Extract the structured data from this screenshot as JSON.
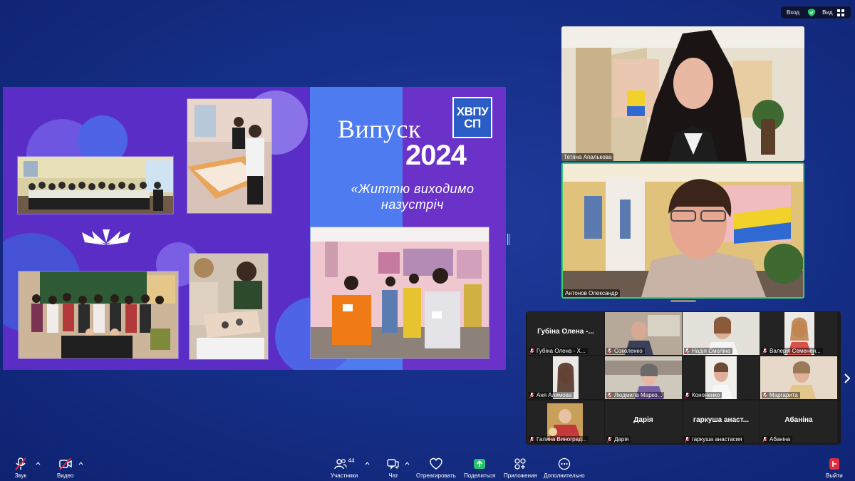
{
  "top_bar": {
    "sign_in_label": "Вход",
    "view_label": "Вид"
  },
  "slide": {
    "title": "Випуск",
    "year": "2024",
    "logo_line1": "ХВПУ",
    "logo_line2": "СП",
    "slogan": "«Життю виходимо назустріч"
  },
  "speakers": [
    {
      "name": "Тетяна Апалькова"
    },
    {
      "name": "Антонов Олександр"
    }
  ],
  "gallery": {
    "participants": [
      {
        "big_name": "Губіна Олена -...",
        "label": "Губіна Олена - Х...",
        "muted": true
      },
      {
        "big_name": "",
        "label": "Соколенко",
        "muted": true
      },
      {
        "big_name": "",
        "label": "Надія Смоліна",
        "muted": true
      },
      {
        "big_name": "",
        "label": "Валерія Семенен...",
        "muted": true
      },
      {
        "big_name": "",
        "label": "Аня Алимова",
        "muted": true
      },
      {
        "big_name": "",
        "label": "Людмила Марко...",
        "muted": true
      },
      {
        "big_name": "",
        "label": "Кононенко",
        "muted": true
      },
      {
        "big_name": "",
        "label": "Маргарита",
        "muted": true
      },
      {
        "big_name": "",
        "label": "Галина Виноград...",
        "muted": true
      },
      {
        "big_name": "Дарія",
        "label": "Дарія",
        "muted": true
      },
      {
        "big_name": "гаркуша анаст...",
        "label": "гаркуша анастасия",
        "muted": true
      },
      {
        "big_name": "Абаніна",
        "label": "Абаніна",
        "muted": true
      }
    ]
  },
  "toolbar": {
    "audio": "Звук",
    "video": "Видео",
    "participants": "Участники",
    "participants_count": "44",
    "chat": "Чат",
    "react": "Отреагировать",
    "share": "Поделиться",
    "apps": "Приложения",
    "more": "Дополнительно",
    "leave": "Выйти"
  },
  "colors": {
    "background": "#16308a",
    "slide_purple": "#5a2ec6",
    "slide_blue": "#4e7cf0",
    "share_green": "#23c46b",
    "leave_red": "#e02b3a",
    "active_speaker_border": "#3bd16f"
  }
}
